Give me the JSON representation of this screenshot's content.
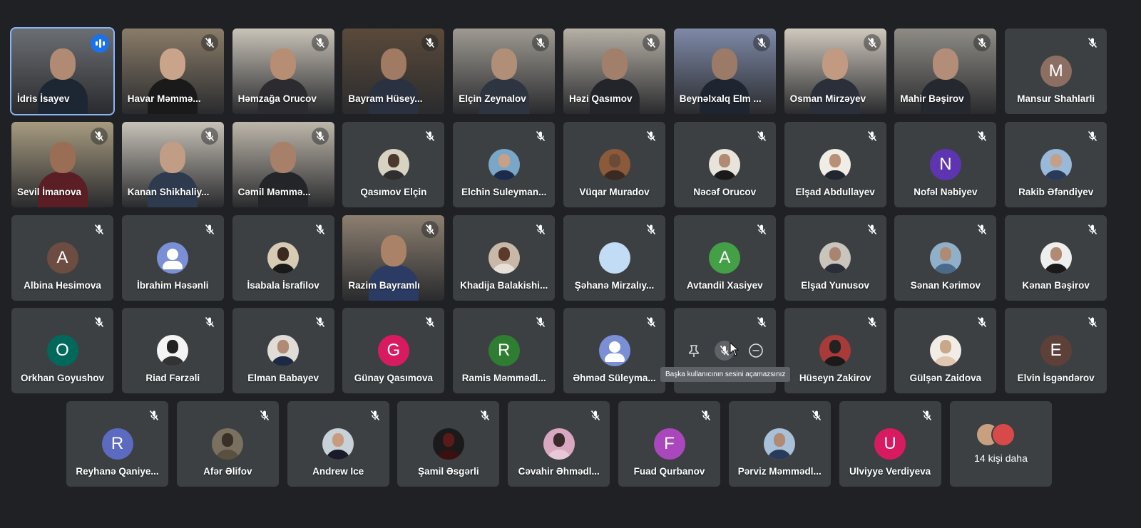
{
  "tooltip": "Başka kullanıcının sesini açamazsınız",
  "more": {
    "label": "14 kişi daha"
  },
  "participants": [
    {
      "name": "İdris İsayev",
      "kind": "video",
      "speaking": true,
      "wall": "#6b6e73",
      "head": "#b08a72",
      "body": "#1d2733"
    },
    {
      "name": "Havar Məmmə...",
      "kind": "video",
      "wall": "#8a7c68",
      "head": "#c9a48a",
      "body": "#1a1a1a"
    },
    {
      "name": "Həmzağa Orucov",
      "kind": "video",
      "wall": "#c9c3b8",
      "head": "#b78d74",
      "body": "#2b2b30"
    },
    {
      "name": "Bayram Hüsey...",
      "kind": "video",
      "wall": "#5a4a3a",
      "head": "#a07a62",
      "body": "#2a3140"
    },
    {
      "name": "Elçin Zeynalov",
      "kind": "video",
      "wall": "#9e9a92",
      "head": "#b08e78",
      "body": "#2e3440"
    },
    {
      "name": "Həzi Qasımov",
      "kind": "video",
      "wall": "#b6b0a6",
      "head": "#a27f6a",
      "body": "#23252b"
    },
    {
      "name": "Beynəlxalq Elm ...",
      "kind": "video",
      "wall": "#7f8aa8",
      "head": "#9b7a68",
      "body": "#1e2430"
    },
    {
      "name": "Osman Mirzəyev",
      "kind": "video",
      "wall": "#cfc8bd",
      "head": "#c29a82",
      "body": "#2a2f3a"
    },
    {
      "name": "Mahir Bəşirov",
      "kind": "video",
      "wall": "#8f8c86",
      "head": "#b48d78",
      "body": "#262830"
    },
    {
      "name": "Mansur Shahlarli",
      "kind": "letter",
      "letter": "M",
      "bg": "#8d6e63"
    },
    {
      "name": "Sevil İmanova",
      "kind": "video",
      "wall": "#a79b80",
      "head": "#9a6e55",
      "body": "#5b1e24"
    },
    {
      "name": "Kanan Shikhaliy...",
      "kind": "video",
      "wall": "#c7c2b8",
      "head": "#c29d85",
      "body": "#2e3b4e"
    },
    {
      "name": "Cəmil Məmmə...",
      "kind": "video",
      "wall": "#bdb6aa",
      "head": "#a7806a",
      "body": "#232528"
    },
    {
      "name": "Qasımov Elçin",
      "kind": "photo",
      "bg": "#d8d2c2",
      "head": "#4a3a2e",
      "body": "#2f2f2f"
    },
    {
      "name": "Elchin Suleyman...",
      "kind": "photo",
      "bg": "#7aa6c8",
      "head": "#c8a088",
      "body": "#1d2b4a"
    },
    {
      "name": "Vüqar Muradov",
      "kind": "photo",
      "bg": "#8a5a3a",
      "head": "#6b4a38",
      "body": "#3a2a22"
    },
    {
      "name": "Nəcəf Orucov",
      "kind": "photo",
      "bg": "#e8e4dc",
      "head": "#b08a72",
      "body": "#1a1a1a"
    },
    {
      "name": "Elşad Abdullayev",
      "kind": "photo",
      "bg": "#f0ece6",
      "head": "#b89078",
      "body": "#222630"
    },
    {
      "name": "Nofəl Nəbiyev",
      "kind": "letter",
      "letter": "N",
      "bg": "#5e35b1"
    },
    {
      "name": "Rakib Əfəndiyev",
      "kind": "photo",
      "bg": "#9ab8d8",
      "head": "#c4a08a",
      "body": "#2a3a58"
    },
    {
      "name": "Albina Hesimova",
      "kind": "letter",
      "letter": "A",
      "bg": "#6d4c41"
    },
    {
      "name": "İbrahim Həsənli",
      "kind": "generic"
    },
    {
      "name": "İsabala İsrafilov",
      "kind": "photo",
      "bg": "#d8cbb4",
      "head": "#3a2a20",
      "body": "#1a1a1a"
    },
    {
      "name": "Razim Bayramlı",
      "kind": "video",
      "wall": "#8c7f70",
      "head": "#a98268",
      "body": "#2b3b64"
    },
    {
      "name": "Khadija Balakishi...",
      "kind": "photo",
      "bg": "#c8b8a8",
      "head": "#5a3a2a",
      "body": "#e8e0d8"
    },
    {
      "name": "Şəhanə Mirzalıy...",
      "kind": "letter",
      "letter": "",
      "bg": "#c2dcf5"
    },
    {
      "name": "Avtandil Xasiyev",
      "kind": "letter",
      "letter": "A",
      "bg": "#43a047"
    },
    {
      "name": "Elşad Yunusov",
      "kind": "photo",
      "bg": "#c9c4bc",
      "head": "#a98470",
      "body": "#2a2e38"
    },
    {
      "name": "Sənan Kərimov",
      "kind": "photo",
      "bg": "#8fb0c8",
      "head": "#b08a72",
      "body": "#4a6a8a"
    },
    {
      "name": "Kənan Bəşirov",
      "kind": "photo",
      "bg": "#eeeeee",
      "head": "#b08a72",
      "body": "#1a1a1a"
    },
    {
      "name": "Orkhan Goyushov",
      "kind": "letter",
      "letter": "O",
      "bg": "#00695c"
    },
    {
      "name": "Riad Fərzəli",
      "kind": "photo",
      "bg": "#f4f4f4",
      "head": "#222222",
      "body": "#333333"
    },
    {
      "name": "Elman Babayev",
      "kind": "photo",
      "bg": "#e0dcd6",
      "head": "#b08a72",
      "body": "#1e2a44"
    },
    {
      "name": "Günay Qasımova",
      "kind": "letter",
      "letter": "G",
      "bg": "#d81b60"
    },
    {
      "name": "Ramis Məmmədl...",
      "kind": "letter",
      "letter": "R",
      "bg": "#2e7d32"
    },
    {
      "name": "Əhməd Süleyma...",
      "kind": "generic"
    },
    {
      "name": "",
      "kind": "hover"
    },
    {
      "name": "Hüseyn Zakirov",
      "kind": "photo",
      "bg": "#a83a3a",
      "head": "#222222",
      "body": "#1a1a1a"
    },
    {
      "name": "Gülşən Zaidova",
      "kind": "photo",
      "bg": "#f2ece6",
      "head": "#c8a888",
      "body": "#e0c8b0"
    },
    {
      "name": "Elvin İsgəndərov",
      "kind": "letter",
      "letter": "E",
      "bg": "#5d4037"
    },
    {
      "name": "Reyhanə Qaniye...",
      "kind": "letter",
      "letter": "R",
      "bg": "#5c6bc0"
    },
    {
      "name": "Afər Əlifov",
      "kind": "photo",
      "bg": "#7a7060",
      "head": "#3a3028",
      "body": "#5a5040"
    },
    {
      "name": "Andrew Ice",
      "kind": "photo",
      "bg": "#c8d0d8",
      "head": "#c89a80",
      "body": "#1a1a2a"
    },
    {
      "name": "Şamil Əsgərli",
      "kind": "photo",
      "bg": "#1a1a1a",
      "head": "#5a1a1a",
      "body": "#3a1010"
    },
    {
      "name": "Cəvahir Əhmədl...",
      "kind": "photo",
      "bg": "#d8a8c0",
      "head": "#3a2a2a",
      "body": "#e8c8d8"
    },
    {
      "name": "Fuad Qurbanov",
      "kind": "letter",
      "letter": "F",
      "bg": "#ab47bc"
    },
    {
      "name": "Pərviz Məmmədl...",
      "kind": "photo",
      "bg": "#a8c0d8",
      "head": "#b08a72",
      "body": "#2a3a5a"
    },
    {
      "name": "Ulviyye Verdiyeva",
      "kind": "letter",
      "letter": "U",
      "bg": "#d81b60"
    }
  ]
}
